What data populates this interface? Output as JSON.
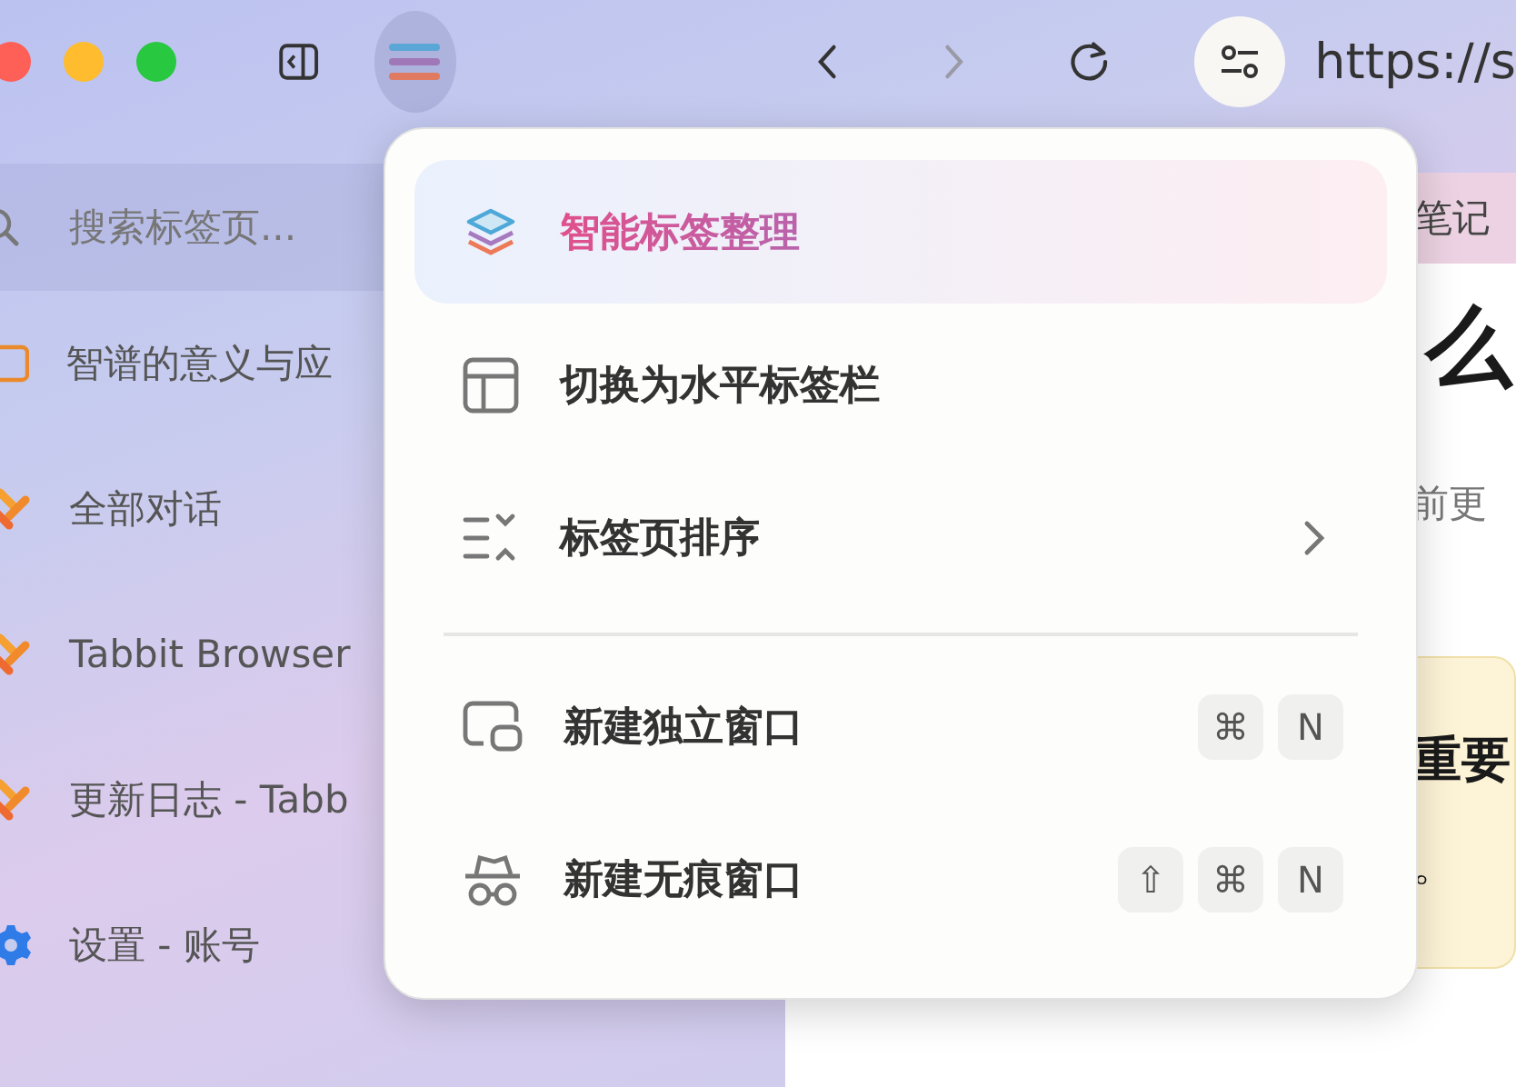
{
  "toolbar": {
    "menu_button": {
      "active": true
    },
    "back": {
      "disabled": false
    },
    "forward": {
      "disabled": true
    },
    "address": "https://s"
  },
  "sidebar": {
    "search": {
      "placeholder": "搜索标签页..."
    },
    "tabs": [
      {
        "title": "智谱的意义与应"
      },
      {
        "title": "全部对话"
      },
      {
        "title": "Tabbit Browser"
      },
      {
        "title": "更新日志 - Tabb"
      },
      {
        "title": "设置 - 账号"
      }
    ]
  },
  "page": {
    "tab_text": "笔记",
    "heading": "么",
    "line": "前更",
    "notice": {
      "title": "重要",
      "text": "。"
    }
  },
  "menu": {
    "items": [
      {
        "kind": "item",
        "label": "智能标签整理",
        "highlighted": true,
        "has_submenu": false
      },
      {
        "kind": "item",
        "label": "切换为水平标签栏",
        "highlighted": false,
        "has_submenu": false
      },
      {
        "kind": "item",
        "label": "标签页排序",
        "highlighted": false,
        "has_submenu": true
      },
      {
        "kind": "separator"
      },
      {
        "kind": "item",
        "label": "新建独立窗口",
        "highlighted": false,
        "has_submenu": false,
        "shortcut": [
          "⌘",
          "N"
        ]
      },
      {
        "kind": "item",
        "label": "新建无痕窗口",
        "highlighted": false,
        "has_submenu": false,
        "shortcut": [
          "⇧",
          "⌘",
          "N"
        ]
      }
    ]
  }
}
